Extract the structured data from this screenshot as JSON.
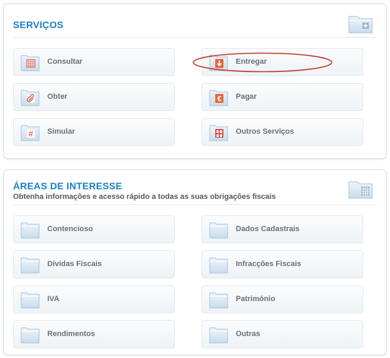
{
  "colors": {
    "accent": "#1b7fc4",
    "annotation": "#c0392b"
  },
  "services": {
    "title": "SERVIÇOS",
    "header_icon": "folder-plus-icon",
    "items": [
      {
        "label": "Consultar",
        "icon": "calendar-icon"
      },
      {
        "label": "Entregar",
        "icon": "download-arrow-icon"
      },
      {
        "label": "Obter",
        "icon": "paperclip-icon"
      },
      {
        "label": "Pagar",
        "icon": "euro-icon"
      },
      {
        "label": "Simular",
        "icon": "hash-icon"
      },
      {
        "label": "Outros Serviços",
        "icon": "building-icon"
      }
    ]
  },
  "areas": {
    "title": "ÁREAS DE INTERESSE",
    "subtitle": "Obtenha informações e acesso rápido a todas as suas obrigações fiscais",
    "header_icon": "folder-grid-icon",
    "items": [
      {
        "label": "Contencioso",
        "icon": "folder-icon"
      },
      {
        "label": "Dados Cadastrais",
        "icon": "folder-icon"
      },
      {
        "label": "Dívidas Fiscais",
        "icon": "folder-icon"
      },
      {
        "label": "Infracções Fiscais",
        "icon": "folder-icon"
      },
      {
        "label": "IVA",
        "icon": "folder-icon"
      },
      {
        "label": "Património",
        "icon": "folder-icon"
      },
      {
        "label": "Rendimentos",
        "icon": "folder-icon"
      },
      {
        "label": "Outras",
        "icon": "folder-icon"
      }
    ]
  }
}
